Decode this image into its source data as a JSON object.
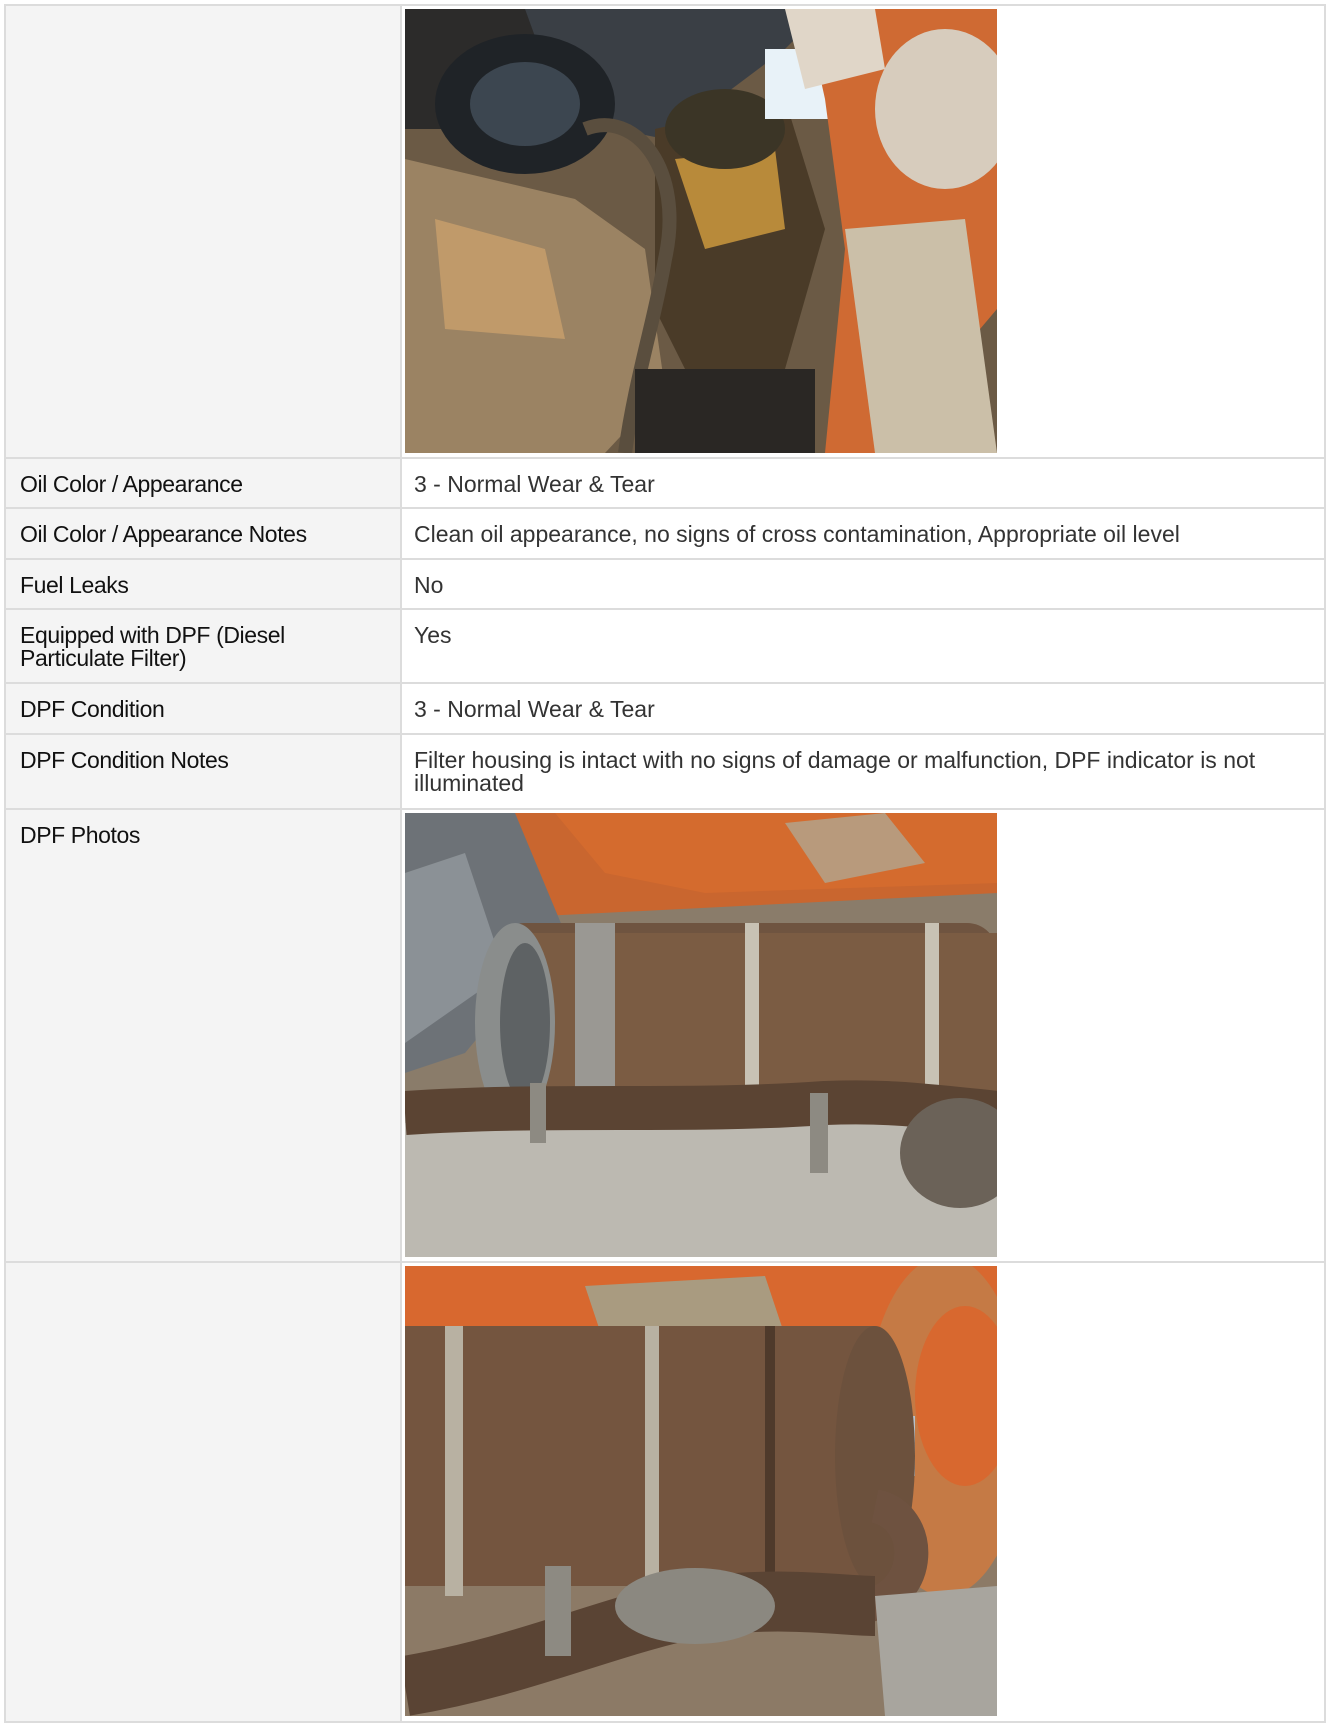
{
  "rows": [
    {
      "label": "Oil Color / Appearance",
      "value": "3 - Normal Wear & Tear"
    },
    {
      "label": "Oil Color / Appearance Notes",
      "value": "Clean oil appearance, no signs of cross contamination, Appropriate oil level"
    },
    {
      "label": "Fuel Leaks",
      "value": "No"
    },
    {
      "label": "Equipped with DPF (Diesel Particulate Filter)",
      "value": "Yes"
    },
    {
      "label": "DPF Condition",
      "value": "3 - Normal Wear & Tear"
    },
    {
      "label": "DPF Condition Notes",
      "value": "Filter housing is intact with no signs of damage or malfunction, DPF indicator is not illuminated"
    },
    {
      "label": "DPF Photos",
      "value": ""
    }
  ],
  "photos": [
    {
      "subject": "engine-oil-area-photo"
    },
    {
      "subject": "dpf-photo-1"
    },
    {
      "subject": "dpf-photo-2"
    }
  ],
  "colors": {
    "border": "#dcdcdc",
    "label_background": "#f4f4f4",
    "value_background": "#ffffff",
    "accent_orange": "#d8682f"
  }
}
